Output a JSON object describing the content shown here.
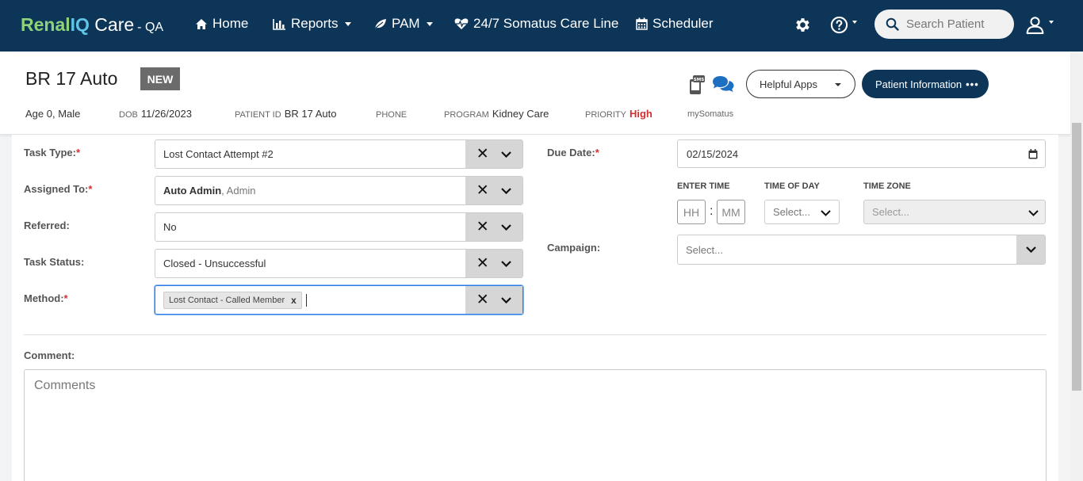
{
  "nav": {
    "logo": {
      "renal": "Renal",
      "iq": "IQ",
      "care": " Care",
      "env": "- QA"
    },
    "home": "Home",
    "reports": "Reports",
    "pam": "PAM",
    "careline": "24/7 Somatus Care Line",
    "scheduler": "Scheduler",
    "search_placeholder": "Search Patient"
  },
  "patient": {
    "name": "BR 17 Auto",
    "badge": "NEW",
    "age_sex": "Age 0, Male",
    "dob_label": "DOB",
    "dob": "11/26/2023",
    "pid_label": "PATIENT ID",
    "pid": "BR 17 Auto",
    "phone_label": "PHONE",
    "program_label": "PROGRAM",
    "program": "Kidney Care",
    "priority_label": "PRIORITY",
    "priority": "High",
    "my_somatus": "mySomatus",
    "helpful_apps": "Helpful Apps",
    "patient_info": "Patient Information",
    "patient_info_dots": "•••"
  },
  "form": {
    "task_type_label": "Task Type:",
    "task_type": "Lost Contact Attempt #2",
    "assigned_label": "Assigned To:",
    "assigned_name": "Auto Admin",
    "assigned_role": ", Admin",
    "referred_label": "Referred:",
    "referred": "No",
    "status_label": "Task Status:",
    "status": "Closed - Unsuccessful",
    "method_label": "Method:",
    "method_chip": "Lost Contact - Called Member",
    "due_label": "Due Date:",
    "due": "02/15/2024",
    "enter_time": "ENTER TIME",
    "time_of_day": "TIME OF DAY",
    "time_zone": "TIME ZONE",
    "hh": "HH",
    "mm": "MM",
    "tod_placeholder": "Select...",
    "tz_placeholder": "Select...",
    "campaign_label": "Campaign:",
    "campaign_placeholder": "Select...",
    "comment_label": "Comment:",
    "comment_placeholder": "Comments",
    "required_mark": "*"
  }
}
